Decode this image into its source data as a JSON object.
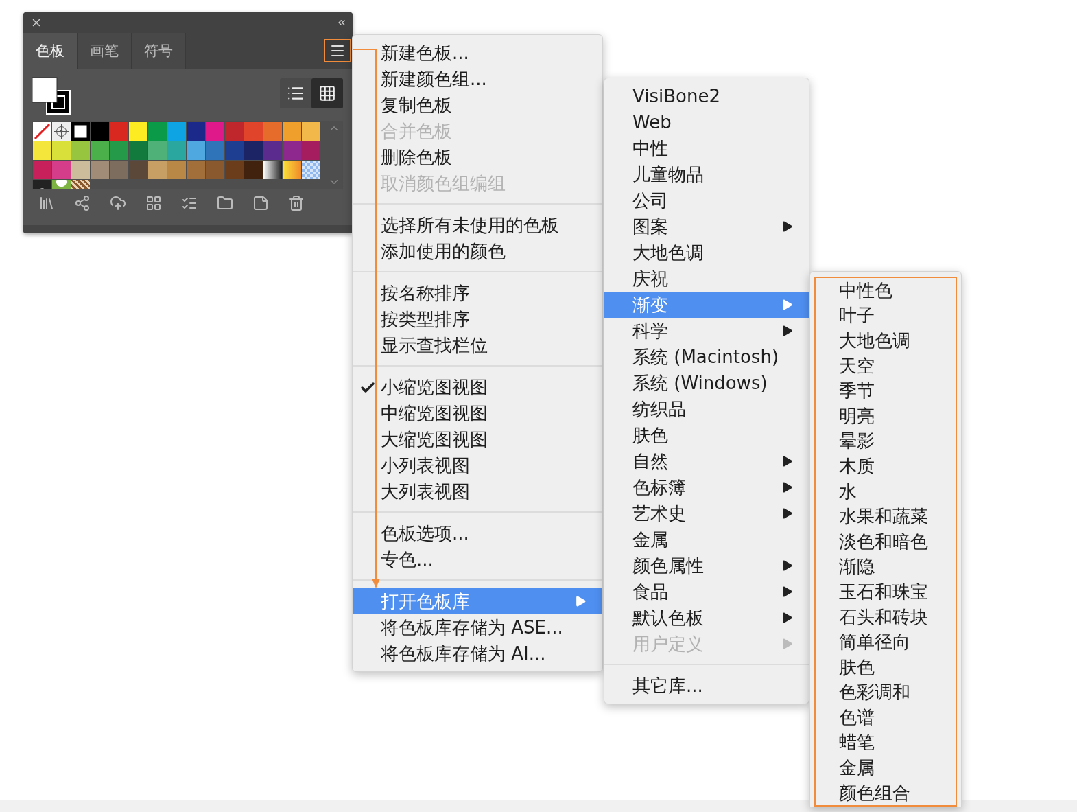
{
  "panel": {
    "tabs": [
      {
        "label": "色板",
        "selected": true
      },
      {
        "label": "画笔",
        "selected": false
      },
      {
        "label": "符号",
        "selected": false
      }
    ],
    "view_toggle": [
      {
        "kind": "list",
        "selected": false
      },
      {
        "kind": "grid",
        "selected": true
      }
    ],
    "swatches": [
      {
        "kind": "none"
      },
      {
        "kind": "registration"
      },
      {
        "kind": "white"
      },
      {
        "kind": "solid",
        "color": "#000000"
      },
      {
        "kind": "solid",
        "color": "#d8281f"
      },
      {
        "kind": "solid",
        "color": "#fdec22"
      },
      {
        "kind": "solid",
        "color": "#0a9a48"
      },
      {
        "kind": "solid",
        "color": "#0ea4e4"
      },
      {
        "kind": "solid",
        "color": "#1b2a8a"
      },
      {
        "kind": "solid",
        "color": "#e0198a"
      },
      {
        "kind": "solid",
        "color": "#c0272d"
      },
      {
        "kind": "solid",
        "color": "#e0452b"
      },
      {
        "kind": "solid",
        "color": "#e66c2c"
      },
      {
        "kind": "solid",
        "color": "#ef9f2b"
      },
      {
        "kind": "solid",
        "color": "#f3b84a"
      },
      {
        "kind": "solid",
        "color": "#f5e63b"
      },
      {
        "kind": "solid",
        "color": "#d9e03a"
      },
      {
        "kind": "solid",
        "color": "#98c53f"
      },
      {
        "kind": "solid",
        "color": "#4cb04a"
      },
      {
        "kind": "solid",
        "color": "#259a48"
      },
      {
        "kind": "solid",
        "color": "#137a3d"
      },
      {
        "kind": "solid",
        "color": "#4fb178"
      },
      {
        "kind": "solid",
        "color": "#2aa79e"
      },
      {
        "kind": "solid",
        "color": "#4fa8df"
      },
      {
        "kind": "solid",
        "color": "#2f73b8"
      },
      {
        "kind": "solid",
        "color": "#1d3e91"
      },
      {
        "kind": "solid",
        "color": "#1c2466"
      },
      {
        "kind": "solid",
        "color": "#5b2c8d"
      },
      {
        "kind": "solid",
        "color": "#8e278e"
      },
      {
        "kind": "solid",
        "color": "#a51c5f"
      },
      {
        "kind": "solid",
        "color": "#c8205a"
      },
      {
        "kind": "solid",
        "color": "#d53c8a"
      },
      {
        "kind": "solid",
        "color": "#cdbc9b"
      },
      {
        "kind": "solid",
        "color": "#a18d77"
      },
      {
        "kind": "solid",
        "color": "#7d6d5e"
      },
      {
        "kind": "solid",
        "color": "#5b4838"
      },
      {
        "kind": "solid",
        "color": "#c79e63"
      },
      {
        "kind": "solid",
        "color": "#b98846"
      },
      {
        "kind": "solid",
        "color": "#a26f3a"
      },
      {
        "kind": "solid",
        "color": "#8a5a2e"
      },
      {
        "kind": "solid",
        "color": "#6b3d1a"
      },
      {
        "kind": "solid",
        "color": "#40220f"
      },
      {
        "kind": "gradient-gray"
      },
      {
        "kind": "gradient-yellow"
      },
      {
        "kind": "pattern-blue"
      },
      {
        "kind": "pattern-dots"
      },
      {
        "kind": "pattern-green"
      },
      {
        "kind": "pattern-brown"
      }
    ]
  },
  "main_menu": {
    "groups": [
      [
        {
          "label": "新建色板...",
          "disabled": false,
          "checked": false,
          "submenu": false,
          "selected": false
        },
        {
          "label": "新建颜色组...",
          "disabled": false,
          "checked": false,
          "submenu": false,
          "selected": false
        },
        {
          "label": "复制色板",
          "disabled": false,
          "checked": false,
          "submenu": false,
          "selected": false
        },
        {
          "label": "合并色板",
          "disabled": true,
          "checked": false,
          "submenu": false,
          "selected": false
        },
        {
          "label": "删除色板",
          "disabled": false,
          "checked": false,
          "submenu": false,
          "selected": false
        },
        {
          "label": "取消颜色组编组",
          "disabled": true,
          "checked": false,
          "submenu": false,
          "selected": false
        }
      ],
      [
        {
          "label": "选择所有未使用的色板",
          "disabled": false,
          "checked": false,
          "submenu": false,
          "selected": false
        },
        {
          "label": "添加使用的颜色",
          "disabled": false,
          "checked": false,
          "submenu": false,
          "selected": false
        }
      ],
      [
        {
          "label": "按名称排序",
          "disabled": false,
          "checked": false,
          "submenu": false,
          "selected": false
        },
        {
          "label": "按类型排序",
          "disabled": false,
          "checked": false,
          "submenu": false,
          "selected": false
        },
        {
          "label": "显示查找栏位",
          "disabled": false,
          "checked": false,
          "submenu": false,
          "selected": false
        }
      ],
      [
        {
          "label": "小缩览图视图",
          "disabled": false,
          "checked": true,
          "submenu": false,
          "selected": false
        },
        {
          "label": "中缩览图视图",
          "disabled": false,
          "checked": false,
          "submenu": false,
          "selected": false
        },
        {
          "label": "大缩览图视图",
          "disabled": false,
          "checked": false,
          "submenu": false,
          "selected": false
        },
        {
          "label": "小列表视图",
          "disabled": false,
          "checked": false,
          "submenu": false,
          "selected": false
        },
        {
          "label": "大列表视图",
          "disabled": false,
          "checked": false,
          "submenu": false,
          "selected": false
        }
      ],
      [
        {
          "label": "色板选项...",
          "disabled": false,
          "checked": false,
          "submenu": false,
          "selected": false
        },
        {
          "label": "专色...",
          "disabled": false,
          "checked": false,
          "submenu": false,
          "selected": false
        }
      ],
      [
        {
          "label": "打开色板库",
          "disabled": false,
          "checked": false,
          "submenu": true,
          "selected": true
        },
        {
          "label": "将色板库存储为 ASE...",
          "disabled": false,
          "checked": false,
          "submenu": false,
          "selected": false
        },
        {
          "label": "将色板库存储为 AI...",
          "disabled": false,
          "checked": false,
          "submenu": false,
          "selected": false
        }
      ]
    ]
  },
  "library_menu": {
    "groups": [
      [
        {
          "label": "VisiBone2",
          "disabled": false,
          "submenu": false,
          "selected": false
        },
        {
          "label": "Web",
          "disabled": false,
          "submenu": false,
          "selected": false
        },
        {
          "label": "中性",
          "disabled": false,
          "submenu": false,
          "selected": false
        },
        {
          "label": "儿童物品",
          "disabled": false,
          "submenu": false,
          "selected": false
        },
        {
          "label": "公司",
          "disabled": false,
          "submenu": false,
          "selected": false
        },
        {
          "label": "图案",
          "disabled": false,
          "submenu": true,
          "selected": false
        },
        {
          "label": "大地色调",
          "disabled": false,
          "submenu": false,
          "selected": false
        },
        {
          "label": "庆祝",
          "disabled": false,
          "submenu": false,
          "selected": false
        },
        {
          "label": "渐变",
          "disabled": false,
          "submenu": true,
          "selected": true
        },
        {
          "label": "科学",
          "disabled": false,
          "submenu": true,
          "selected": false
        },
        {
          "label": "系统 (Macintosh)",
          "disabled": false,
          "submenu": false,
          "selected": false
        },
        {
          "label": "系统 (Windows)",
          "disabled": false,
          "submenu": false,
          "selected": false
        },
        {
          "label": "纺织品",
          "disabled": false,
          "submenu": false,
          "selected": false
        },
        {
          "label": "肤色",
          "disabled": false,
          "submenu": false,
          "selected": false
        },
        {
          "label": "自然",
          "disabled": false,
          "submenu": true,
          "selected": false
        },
        {
          "label": "色标簿",
          "disabled": false,
          "submenu": true,
          "selected": false
        },
        {
          "label": "艺术史",
          "disabled": false,
          "submenu": true,
          "selected": false
        },
        {
          "label": "金属",
          "disabled": false,
          "submenu": false,
          "selected": false
        },
        {
          "label": "颜色属性",
          "disabled": false,
          "submenu": true,
          "selected": false
        },
        {
          "label": "食品",
          "disabled": false,
          "submenu": true,
          "selected": false
        },
        {
          "label": "默认色板",
          "disabled": false,
          "submenu": true,
          "selected": false
        },
        {
          "label": "用户定义",
          "disabled": true,
          "submenu": true,
          "selected": false
        }
      ],
      [
        {
          "label": "其它库...",
          "disabled": false,
          "submenu": false,
          "selected": false
        }
      ]
    ]
  },
  "gradient_menu": {
    "items": [
      "中性色",
      "叶子",
      "大地色调",
      "天空",
      "季节",
      "明亮",
      "晕影",
      "木质",
      "水",
      "水果和蔬菜",
      "淡色和暗色",
      "渐隐",
      "玉石和珠宝",
      "石头和砖块",
      "简单径向",
      "肤色",
      "色彩调和",
      "色谱",
      "蜡笔",
      "金属",
      "颜色组合"
    ]
  }
}
